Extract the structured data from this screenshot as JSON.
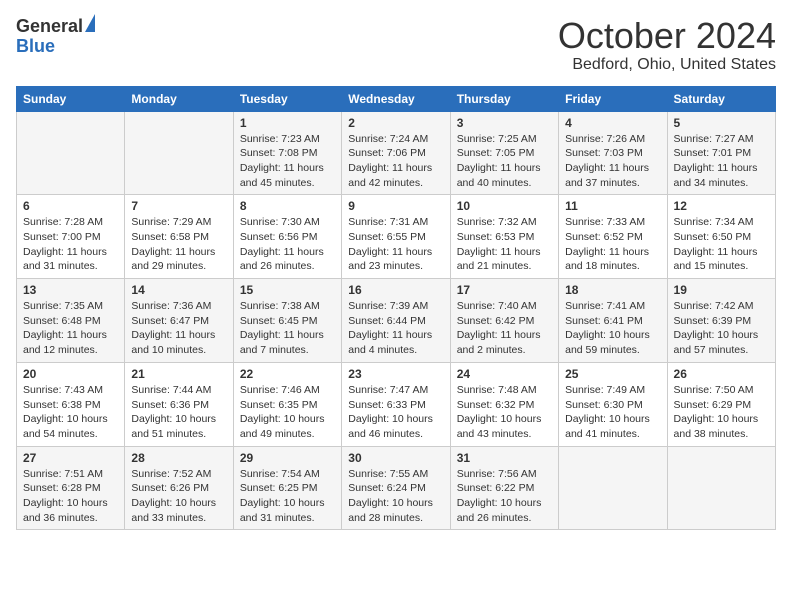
{
  "header": {
    "logo_line1": "General",
    "logo_line2": "Blue",
    "month": "October 2024",
    "location": "Bedford, Ohio, United States"
  },
  "days_of_week": [
    "Sunday",
    "Monday",
    "Tuesday",
    "Wednesday",
    "Thursday",
    "Friday",
    "Saturday"
  ],
  "weeks": [
    [
      {
        "day": "",
        "sunrise": "",
        "sunset": "",
        "daylight": ""
      },
      {
        "day": "",
        "sunrise": "",
        "sunset": "",
        "daylight": ""
      },
      {
        "day": "1",
        "sunrise": "Sunrise: 7:23 AM",
        "sunset": "Sunset: 7:08 PM",
        "daylight": "Daylight: 11 hours and 45 minutes."
      },
      {
        "day": "2",
        "sunrise": "Sunrise: 7:24 AM",
        "sunset": "Sunset: 7:06 PM",
        "daylight": "Daylight: 11 hours and 42 minutes."
      },
      {
        "day": "3",
        "sunrise": "Sunrise: 7:25 AM",
        "sunset": "Sunset: 7:05 PM",
        "daylight": "Daylight: 11 hours and 40 minutes."
      },
      {
        "day": "4",
        "sunrise": "Sunrise: 7:26 AM",
        "sunset": "Sunset: 7:03 PM",
        "daylight": "Daylight: 11 hours and 37 minutes."
      },
      {
        "day": "5",
        "sunrise": "Sunrise: 7:27 AM",
        "sunset": "Sunset: 7:01 PM",
        "daylight": "Daylight: 11 hours and 34 minutes."
      }
    ],
    [
      {
        "day": "6",
        "sunrise": "Sunrise: 7:28 AM",
        "sunset": "Sunset: 7:00 PM",
        "daylight": "Daylight: 11 hours and 31 minutes."
      },
      {
        "day": "7",
        "sunrise": "Sunrise: 7:29 AM",
        "sunset": "Sunset: 6:58 PM",
        "daylight": "Daylight: 11 hours and 29 minutes."
      },
      {
        "day": "8",
        "sunrise": "Sunrise: 7:30 AM",
        "sunset": "Sunset: 6:56 PM",
        "daylight": "Daylight: 11 hours and 26 minutes."
      },
      {
        "day": "9",
        "sunrise": "Sunrise: 7:31 AM",
        "sunset": "Sunset: 6:55 PM",
        "daylight": "Daylight: 11 hours and 23 minutes."
      },
      {
        "day": "10",
        "sunrise": "Sunrise: 7:32 AM",
        "sunset": "Sunset: 6:53 PM",
        "daylight": "Daylight: 11 hours and 21 minutes."
      },
      {
        "day": "11",
        "sunrise": "Sunrise: 7:33 AM",
        "sunset": "Sunset: 6:52 PM",
        "daylight": "Daylight: 11 hours and 18 minutes."
      },
      {
        "day": "12",
        "sunrise": "Sunrise: 7:34 AM",
        "sunset": "Sunset: 6:50 PM",
        "daylight": "Daylight: 11 hours and 15 minutes."
      }
    ],
    [
      {
        "day": "13",
        "sunrise": "Sunrise: 7:35 AM",
        "sunset": "Sunset: 6:48 PM",
        "daylight": "Daylight: 11 hours and 12 minutes."
      },
      {
        "day": "14",
        "sunrise": "Sunrise: 7:36 AM",
        "sunset": "Sunset: 6:47 PM",
        "daylight": "Daylight: 11 hours and 10 minutes."
      },
      {
        "day": "15",
        "sunrise": "Sunrise: 7:38 AM",
        "sunset": "Sunset: 6:45 PM",
        "daylight": "Daylight: 11 hours and 7 minutes."
      },
      {
        "day": "16",
        "sunrise": "Sunrise: 7:39 AM",
        "sunset": "Sunset: 6:44 PM",
        "daylight": "Daylight: 11 hours and 4 minutes."
      },
      {
        "day": "17",
        "sunrise": "Sunrise: 7:40 AM",
        "sunset": "Sunset: 6:42 PM",
        "daylight": "Daylight: 11 hours and 2 minutes."
      },
      {
        "day": "18",
        "sunrise": "Sunrise: 7:41 AM",
        "sunset": "Sunset: 6:41 PM",
        "daylight": "Daylight: 10 hours and 59 minutes."
      },
      {
        "day": "19",
        "sunrise": "Sunrise: 7:42 AM",
        "sunset": "Sunset: 6:39 PM",
        "daylight": "Daylight: 10 hours and 57 minutes."
      }
    ],
    [
      {
        "day": "20",
        "sunrise": "Sunrise: 7:43 AM",
        "sunset": "Sunset: 6:38 PM",
        "daylight": "Daylight: 10 hours and 54 minutes."
      },
      {
        "day": "21",
        "sunrise": "Sunrise: 7:44 AM",
        "sunset": "Sunset: 6:36 PM",
        "daylight": "Daylight: 10 hours and 51 minutes."
      },
      {
        "day": "22",
        "sunrise": "Sunrise: 7:46 AM",
        "sunset": "Sunset: 6:35 PM",
        "daylight": "Daylight: 10 hours and 49 minutes."
      },
      {
        "day": "23",
        "sunrise": "Sunrise: 7:47 AM",
        "sunset": "Sunset: 6:33 PM",
        "daylight": "Daylight: 10 hours and 46 minutes."
      },
      {
        "day": "24",
        "sunrise": "Sunrise: 7:48 AM",
        "sunset": "Sunset: 6:32 PM",
        "daylight": "Daylight: 10 hours and 43 minutes."
      },
      {
        "day": "25",
        "sunrise": "Sunrise: 7:49 AM",
        "sunset": "Sunset: 6:30 PM",
        "daylight": "Daylight: 10 hours and 41 minutes."
      },
      {
        "day": "26",
        "sunrise": "Sunrise: 7:50 AM",
        "sunset": "Sunset: 6:29 PM",
        "daylight": "Daylight: 10 hours and 38 minutes."
      }
    ],
    [
      {
        "day": "27",
        "sunrise": "Sunrise: 7:51 AM",
        "sunset": "Sunset: 6:28 PM",
        "daylight": "Daylight: 10 hours and 36 minutes."
      },
      {
        "day": "28",
        "sunrise": "Sunrise: 7:52 AM",
        "sunset": "Sunset: 6:26 PM",
        "daylight": "Daylight: 10 hours and 33 minutes."
      },
      {
        "day": "29",
        "sunrise": "Sunrise: 7:54 AM",
        "sunset": "Sunset: 6:25 PM",
        "daylight": "Daylight: 10 hours and 31 minutes."
      },
      {
        "day": "30",
        "sunrise": "Sunrise: 7:55 AM",
        "sunset": "Sunset: 6:24 PM",
        "daylight": "Daylight: 10 hours and 28 minutes."
      },
      {
        "day": "31",
        "sunrise": "Sunrise: 7:56 AM",
        "sunset": "Sunset: 6:22 PM",
        "daylight": "Daylight: 10 hours and 26 minutes."
      },
      {
        "day": "",
        "sunrise": "",
        "sunset": "",
        "daylight": ""
      },
      {
        "day": "",
        "sunrise": "",
        "sunset": "",
        "daylight": ""
      }
    ]
  ]
}
